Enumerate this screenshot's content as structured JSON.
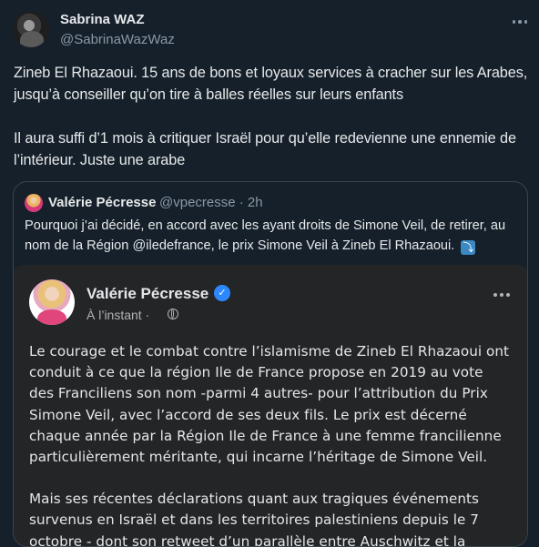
{
  "tweet": {
    "author_name": "Sabrina WAZ",
    "author_handle": "@SabrinaWazWaz",
    "paragraphs": [
      "Zineb El Rhazaoui. 15 ans de bons et loyaux services à cracher sur les Arabes, jusqu’à conseiller qu’on tire à balles réelles sur leurs enfants",
      "Il aura suffi d’1 mois à critiquer Israël pour qu’elle redevienne une ennemie de l’intérieur. Juste une arabe"
    ]
  },
  "quote": {
    "author_name": "Valérie Pécresse",
    "author_handle": "@vpecresse · 2h",
    "text": "Pourquoi j’ai décidé, en accord avec les ayant droits de Simone Veil, de retirer, au nom de la Région @iledefrance, le prix Simone Veil à Zineb El Rhazaoui.",
    "emoji": "⤵",
    "inner": {
      "author_name": "Valérie Pécresse",
      "verified_mark": "✓",
      "time": "À l’instant ·",
      "paragraphs": [
        "Le courage et le combat contre l’islamisme de Zineb El Rhazaoui ont conduit à ce que la région Ile de France propose en 2019 au vote des Franciliens son nom -parmi 4 autres- pour l’attribution du Prix Simone Veil, avec l’accord de ses deux fils. Le prix est  décerné chaque année par la Région Ile de France à une femme francilienne particulièrement méritante, qui incarne l’héritage de Simone Veil.",
        "Mais ses récentes déclarations quant aux tragiques événements survenus en Israël et dans les territoires palestiniens depuis le 7 octobre - dont son retweet d’un parallèle entre Auschwitz et la"
      ]
    }
  },
  "colors": {
    "background": "#15202b",
    "text": "#e7e9ea",
    "secondary": "#8b98a5",
    "inner_card": "#242526",
    "verified": "#2d88ff"
  }
}
